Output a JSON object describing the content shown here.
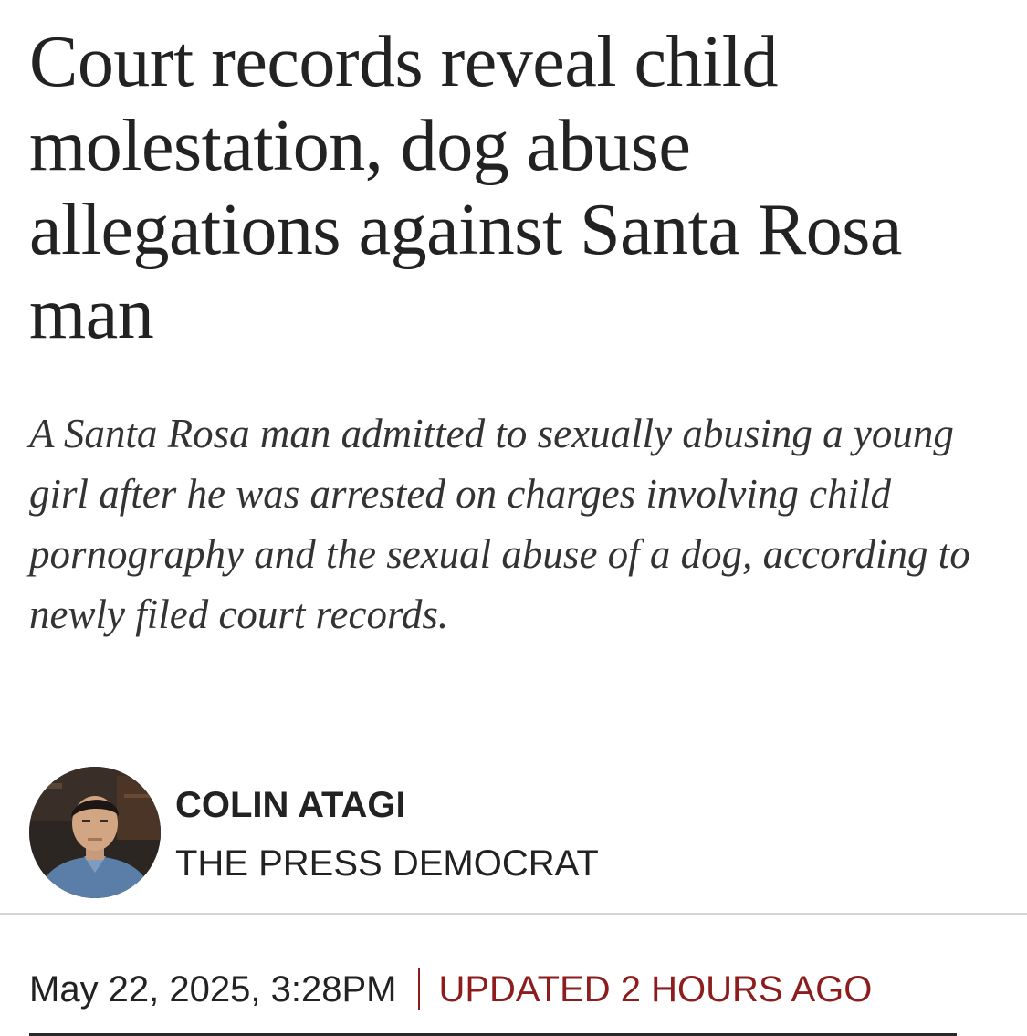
{
  "article": {
    "headline": "Court records reveal child molestation, dog abuse allegations against Santa Rosa man",
    "dek": "A Santa Rosa man admitted to sexually abusing a young girl after he was arrested on charges involving child pornography and the sexual abuse of a dog, according to newly filed court records.",
    "author": {
      "name": "COLIN ATAGI",
      "publication": "THE PRESS DEMOCRAT",
      "avatar_icon": "author-photo"
    },
    "dateline": {
      "published": "May 22, 2025, 3:28PM",
      "updated": "UPDATED 2 HOURS AGO"
    }
  },
  "colors": {
    "text": "#222222",
    "updated_accent": "#8e1c1c",
    "divider": "#d5d5d5"
  }
}
